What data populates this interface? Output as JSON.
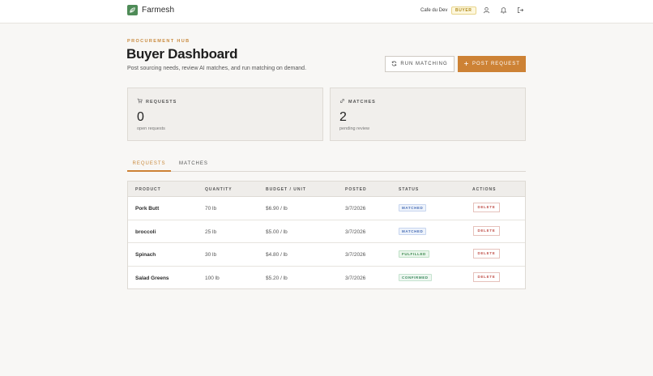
{
  "header": {
    "brand": "Farmesh",
    "user_name": "Cafe du Dev",
    "role": "BUYER"
  },
  "hero": {
    "eyebrow": "PROCUREMENT HUB",
    "title": "Buyer Dashboard",
    "subtitle": "Post sourcing needs, review AI matches, and run matching on demand.",
    "run_matching_label": "RUN MATCHING",
    "post_request_label": "POST REQUEST"
  },
  "stats": {
    "requests": {
      "label": "REQUESTS",
      "value": "0",
      "caption": "open requests"
    },
    "matches": {
      "label": "MATCHES",
      "value": "2",
      "caption": "pending review"
    }
  },
  "tabs": [
    {
      "label": "REQUESTS",
      "active": true
    },
    {
      "label": "MATCHES",
      "active": false
    }
  ],
  "table": {
    "columns": [
      "PRODUCT",
      "QUANTITY",
      "BUDGET / UNIT",
      "POSTED",
      "STATUS",
      "ACTIONS"
    ],
    "rows": [
      {
        "product": "Pork Butt",
        "quantity": "70 lb",
        "budget": "$6.90 / lb",
        "posted": "3/7/2026",
        "status": "MATCHED",
        "action": "DELETE"
      },
      {
        "product": "broccoli",
        "quantity": "25 lb",
        "budget": "$5.00 / lb",
        "posted": "3/7/2026",
        "status": "MATCHED",
        "action": "DELETE"
      },
      {
        "product": "Spinach",
        "quantity": "30 lb",
        "budget": "$4.80 / lb",
        "posted": "3/7/2026",
        "status": "FULFILLED",
        "action": "DELETE"
      },
      {
        "product": "Salad Greens",
        "quantity": "100 lb",
        "budget": "$5.20 / lb",
        "posted": "3/7/2026",
        "status": "CONFIRMED",
        "action": "DELETE"
      }
    ]
  },
  "colors": {
    "accent": "#cd8235",
    "brand_green": "#4e8b57",
    "background": "#f8f7f5"
  },
  "icons": {
    "logo": "leaf-icon",
    "user": "user-icon",
    "notifications": "bell-icon",
    "logout": "logout-icon",
    "run_matching": "refresh-icon",
    "post_request": "plus-icon",
    "requests": "cart-icon",
    "matches": "link-icon"
  }
}
